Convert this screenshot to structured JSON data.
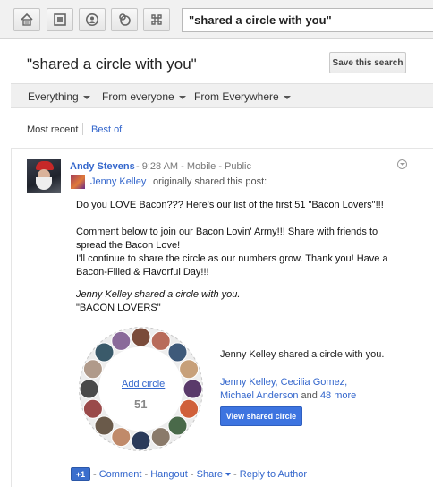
{
  "nav": {
    "icons": [
      "stream-icon",
      "photos-icon",
      "profile-icon",
      "circles-icon",
      "games-icon"
    ],
    "search_value": "\"shared a circle with you\""
  },
  "results": {
    "heading": "\"shared a circle with you\"",
    "save_label": "Save this search",
    "filters": [
      "Everything",
      "From everyone",
      "From Everywhere"
    ],
    "sort_current": "Most recent",
    "sort_other": "Best of"
  },
  "post": {
    "author": "Andy Stevens",
    "meta": "- 9:28 AM - Mobile - Public",
    "sharer": "Jenny Kelley",
    "shared_note": "originally shared this post:",
    "lines": [
      "Do you LOVE Bacon??? Here's our list of the first 51 \"Bacon Lovers\"!!!",
      "Comment below to join our Bacon Lovin' Army!!! Share with friends to",
      "spread the Bacon Love!",
      "I'll continue to share the circle as our numbers grow. Thank you! Have a",
      "Bacon-Filled & Flavorful Day!!!"
    ],
    "shared_circle_line": "Jenny Kelley shared a circle with you.",
    "circle_name": "\"BACON LOVERS\"",
    "circle": {
      "add_label": "Add circle",
      "count": "51",
      "title": "Jenny Kelley shared a circle with you.",
      "members": "Jenny Kelley, Cecilia Gomez,",
      "members2": "Michael Anderson",
      "and_word": "and",
      "more": "48 more",
      "view_label": "View shared circle"
    },
    "actions": {
      "plusone": "+1",
      "comment": "Comment",
      "hangout": "Hangout",
      "share": "Share",
      "reply": "Reply to Author"
    }
  },
  "colors": {
    "link": "#3366cc",
    "button_blue": "#3d74e0"
  }
}
